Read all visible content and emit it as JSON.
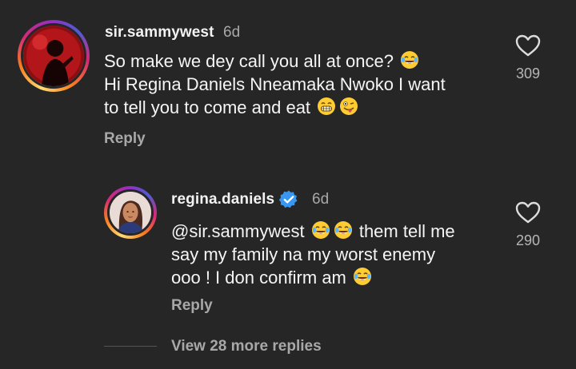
{
  "comments": [
    {
      "username": "sir.sammywest",
      "time": "6d",
      "lines": [
        "So make we dey call you all at once?",
        "Hi Regina Daniels Nneamaka Nwoko I want",
        "to tell you to come and eat"
      ],
      "emoji": [
        "laughing-tears",
        "grinning-teeth",
        "winking-tongue"
      ],
      "reply_label": "Reply",
      "likes": "309"
    },
    {
      "username": "regina.daniels",
      "verified": true,
      "time": "6d",
      "lines": [
        "@sir.sammywest",
        "them tell me",
        "say my family na my worst enemy",
        "ooo ! I don confirm am"
      ],
      "emoji": [
        "laughing-tears",
        "laughing-tears",
        "laughing-tears"
      ],
      "reply_label": "Reply",
      "likes": "290"
    }
  ],
  "view_more": "View 28 more replies",
  "colors": {
    "background": "#262626",
    "text": "#f5f5f5",
    "muted": "#a8a8a8",
    "verified": "#3897f0"
  }
}
